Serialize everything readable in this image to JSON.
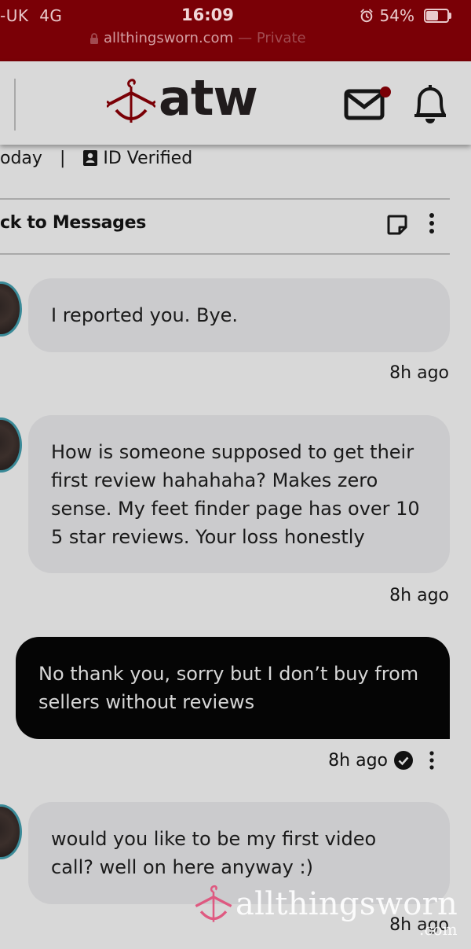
{
  "status_bar": {
    "carrier": "-UK",
    "network": "4G",
    "time": "16:09",
    "battery": "54%",
    "battery_level": 0.54,
    "url": "allthingsworn.com",
    "private_label": "— Private"
  },
  "header": {
    "logo_text": "atw",
    "brand_color": "#7a0006",
    "has_unread_mail": true
  },
  "profile_meta": {
    "left_fragment": "oday",
    "separator": "|",
    "verified_label": "ID Verified"
  },
  "conversation": {
    "back_label": "ck to Messages"
  },
  "messages": [
    {
      "direction": "in",
      "text": "I reported you. Bye.",
      "time": "8h ago"
    },
    {
      "direction": "in",
      "text": "How is someone supposed to get their\nfirst review hahahaha? Makes zero\nsense. My feet finder page has over 10\n5 star reviews. Your loss honestly",
      "time": "8h ago"
    },
    {
      "direction": "out",
      "text": "No thank you, sorry but I don’t buy from\nsellers without reviews",
      "time": "8h ago",
      "read": true
    },
    {
      "direction": "in",
      "text": "would you like to be my first video\ncall? well on here anyway :)",
      "time": "8h ago"
    }
  ],
  "watermark": {
    "text": "allthingsworn",
    "sub": ".com"
  }
}
